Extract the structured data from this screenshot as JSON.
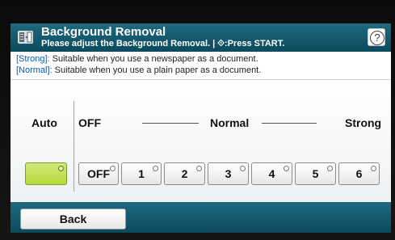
{
  "header": {
    "icon": "background-removal-icon",
    "title": "Background Removal",
    "subtitle": "Please adjust the Background Removal. | ⟐:Press START.",
    "help_icon": "help-icon",
    "help_label": "?"
  },
  "info": {
    "strong_tag": "[Strong]:",
    "strong_text": " Suitable when you use a newspaper as a document.",
    "normal_tag": "[Normal]:",
    "normal_text": " Suitable when you use a plain paper as a document."
  },
  "scale": {
    "auto_label": "Auto",
    "off_label": "OFF",
    "normal_label": "Normal",
    "strong_label": "Strong"
  },
  "levels": {
    "selected": "Auto",
    "auto": "",
    "off": "OFF",
    "l1": "1",
    "l2": "2",
    "l3": "3",
    "l4": "4",
    "l5": "5",
    "l6": "6"
  },
  "footer": {
    "back_label": "Back"
  },
  "colors": {
    "header_bg": "#0d4a5d",
    "selected_green": "#b6da3c",
    "tag_blue": "#0a59b0"
  }
}
